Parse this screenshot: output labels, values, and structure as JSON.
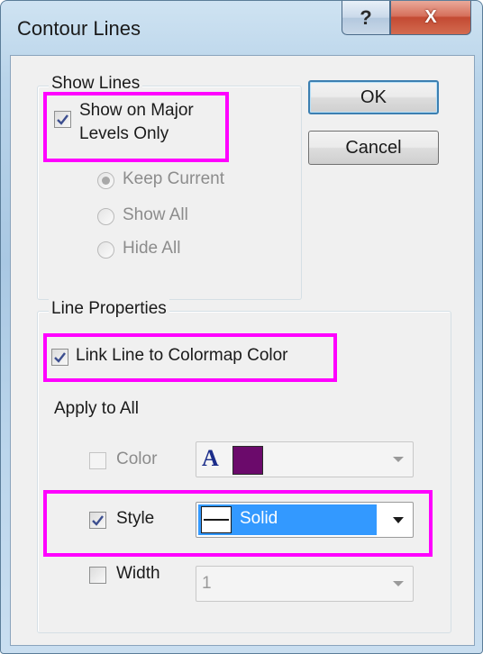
{
  "window": {
    "title": "Contour Lines",
    "help_glyph": "?",
    "close_glyph": "X"
  },
  "show_lines": {
    "group_label": "Show Lines",
    "major_only_label_line1": "Show on Major",
    "major_only_label_line2": "Levels Only",
    "major_only_checked": true,
    "radios": [
      {
        "label": "Keep Current",
        "selected": true,
        "enabled": false
      },
      {
        "label": "Show All",
        "selected": false,
        "enabled": false
      },
      {
        "label": "Hide All",
        "selected": false,
        "enabled": false
      }
    ]
  },
  "buttons": {
    "ok": "OK",
    "cancel": "Cancel"
  },
  "line_properties": {
    "group_label": "Line Properties",
    "link_colormap_label": "Link Line to Colormap Color",
    "link_colormap_checked": true,
    "apply_to_all_label": "Apply to All",
    "color": {
      "label": "Color",
      "checked": false,
      "enabled": false,
      "font_glyph": "A",
      "swatch_color": "#6b0a6b"
    },
    "style": {
      "label": "Style",
      "checked": true,
      "value": "Solid"
    },
    "width": {
      "label": "Width",
      "checked": false,
      "value": "1"
    }
  },
  "colors": {
    "highlight": "#ff00ff",
    "selection": "#3399ff",
    "check": "#3c4e8f"
  }
}
